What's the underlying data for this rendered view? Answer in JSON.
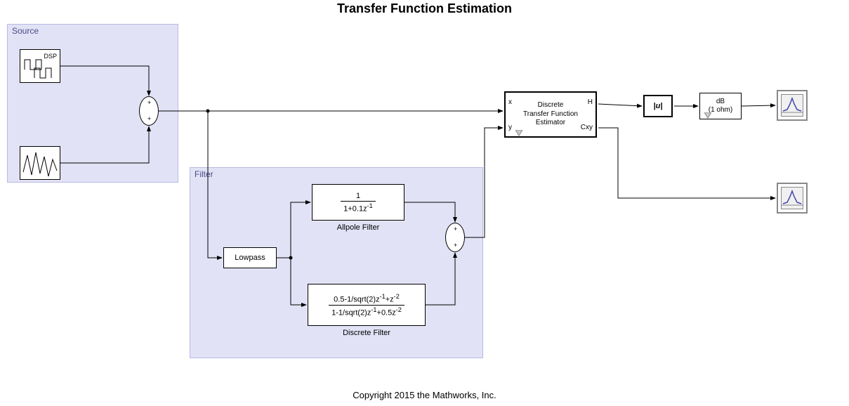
{
  "title": "Transfer Function Estimation",
  "footer": "Copyright 2015 the Mathworks, Inc.",
  "regions": {
    "source": "Source",
    "filter": "Filter"
  },
  "blocks": {
    "dsp_label": "DSP",
    "lowpass": "Lowpass",
    "allpole": {
      "num": "1",
      "den_prefix": "1+0.1z",
      "den_exp": "-1",
      "caption": "Allpole Filter"
    },
    "discrete_filter": {
      "num_a": "0.5-1/sqrt(2)z",
      "num_exp1": "-1",
      "num_mid": "+z",
      "num_exp2": "-2",
      "den_a": "1-1/sqrt(2)z",
      "den_exp1": "-1",
      "den_mid": "+0.5z",
      "den_exp2": "-2",
      "caption": "Discrete Filter"
    },
    "tfe": {
      "line1": "Discrete",
      "line2": "Transfer Function",
      "line3": "Estimator",
      "port_x": "x",
      "port_y": "y",
      "port_H": "H",
      "port_Cxy": "Cxy"
    },
    "abs": "|u|",
    "db": {
      "line1": "dB",
      "line2": "(1 ohm)"
    }
  }
}
